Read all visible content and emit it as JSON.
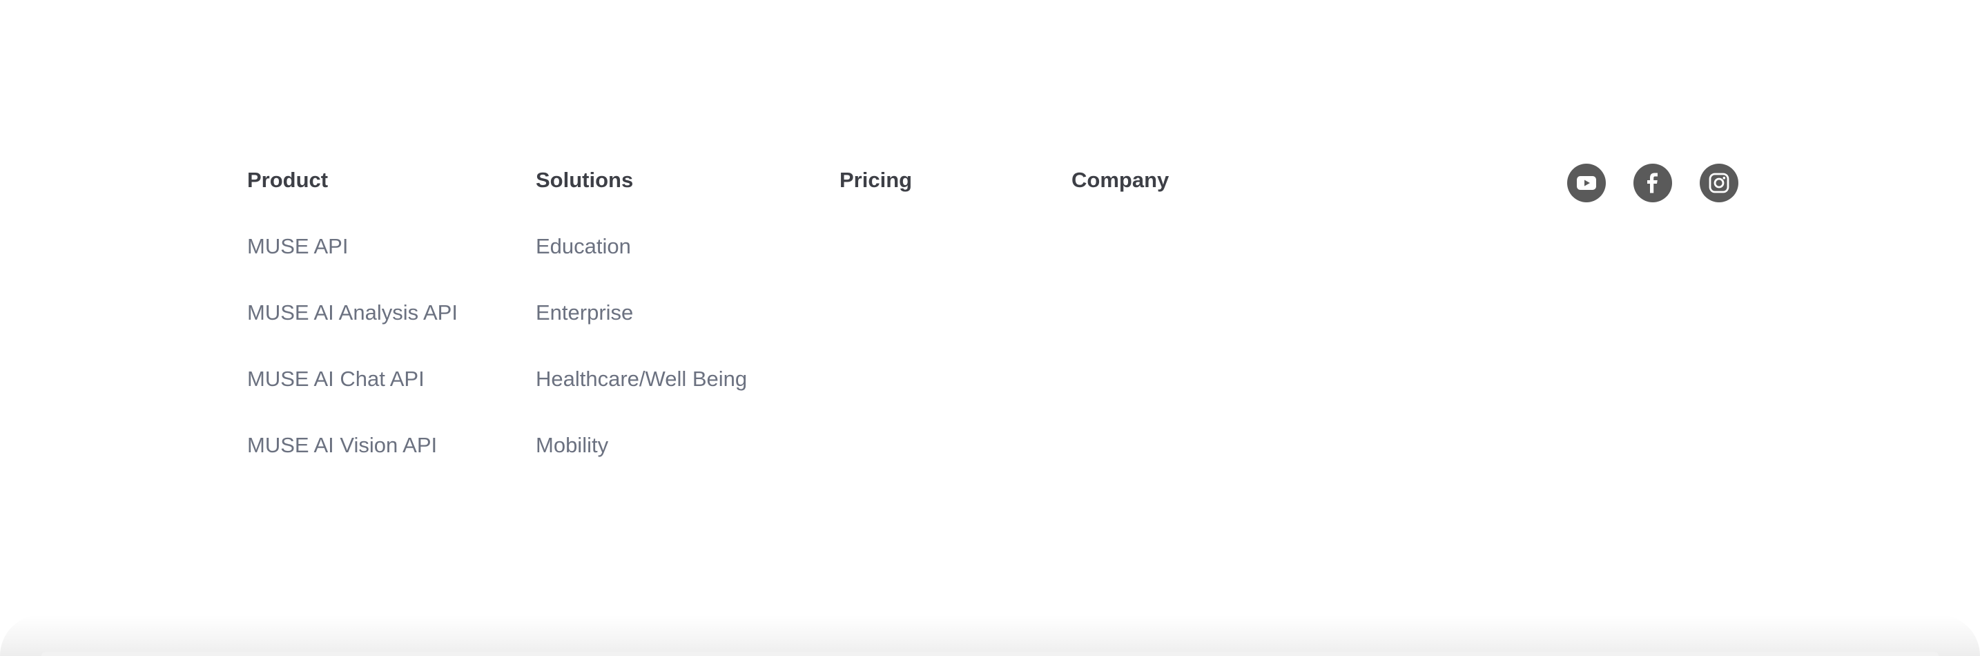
{
  "footer": {
    "columns": [
      {
        "heading": "Product",
        "links": [
          "MUSE API",
          "MUSE AI Analysis API",
          "MUSE AI Chat API",
          "MUSE AI Vision API"
        ]
      },
      {
        "heading": "Solutions",
        "links": [
          "Education",
          "Enterprise",
          "Healthcare/Well Being",
          "Mobility"
        ]
      },
      {
        "heading": "Pricing",
        "links": []
      },
      {
        "heading": "Company",
        "links": []
      }
    ],
    "social": [
      {
        "name": "youtube-icon"
      },
      {
        "name": "facebook-icon"
      },
      {
        "name": "instagram-icon"
      }
    ]
  },
  "colors": {
    "heading": "#3d3f46",
    "link": "#6b7180",
    "social_bg": "#5a5a5a",
    "background": "#ffffff"
  }
}
